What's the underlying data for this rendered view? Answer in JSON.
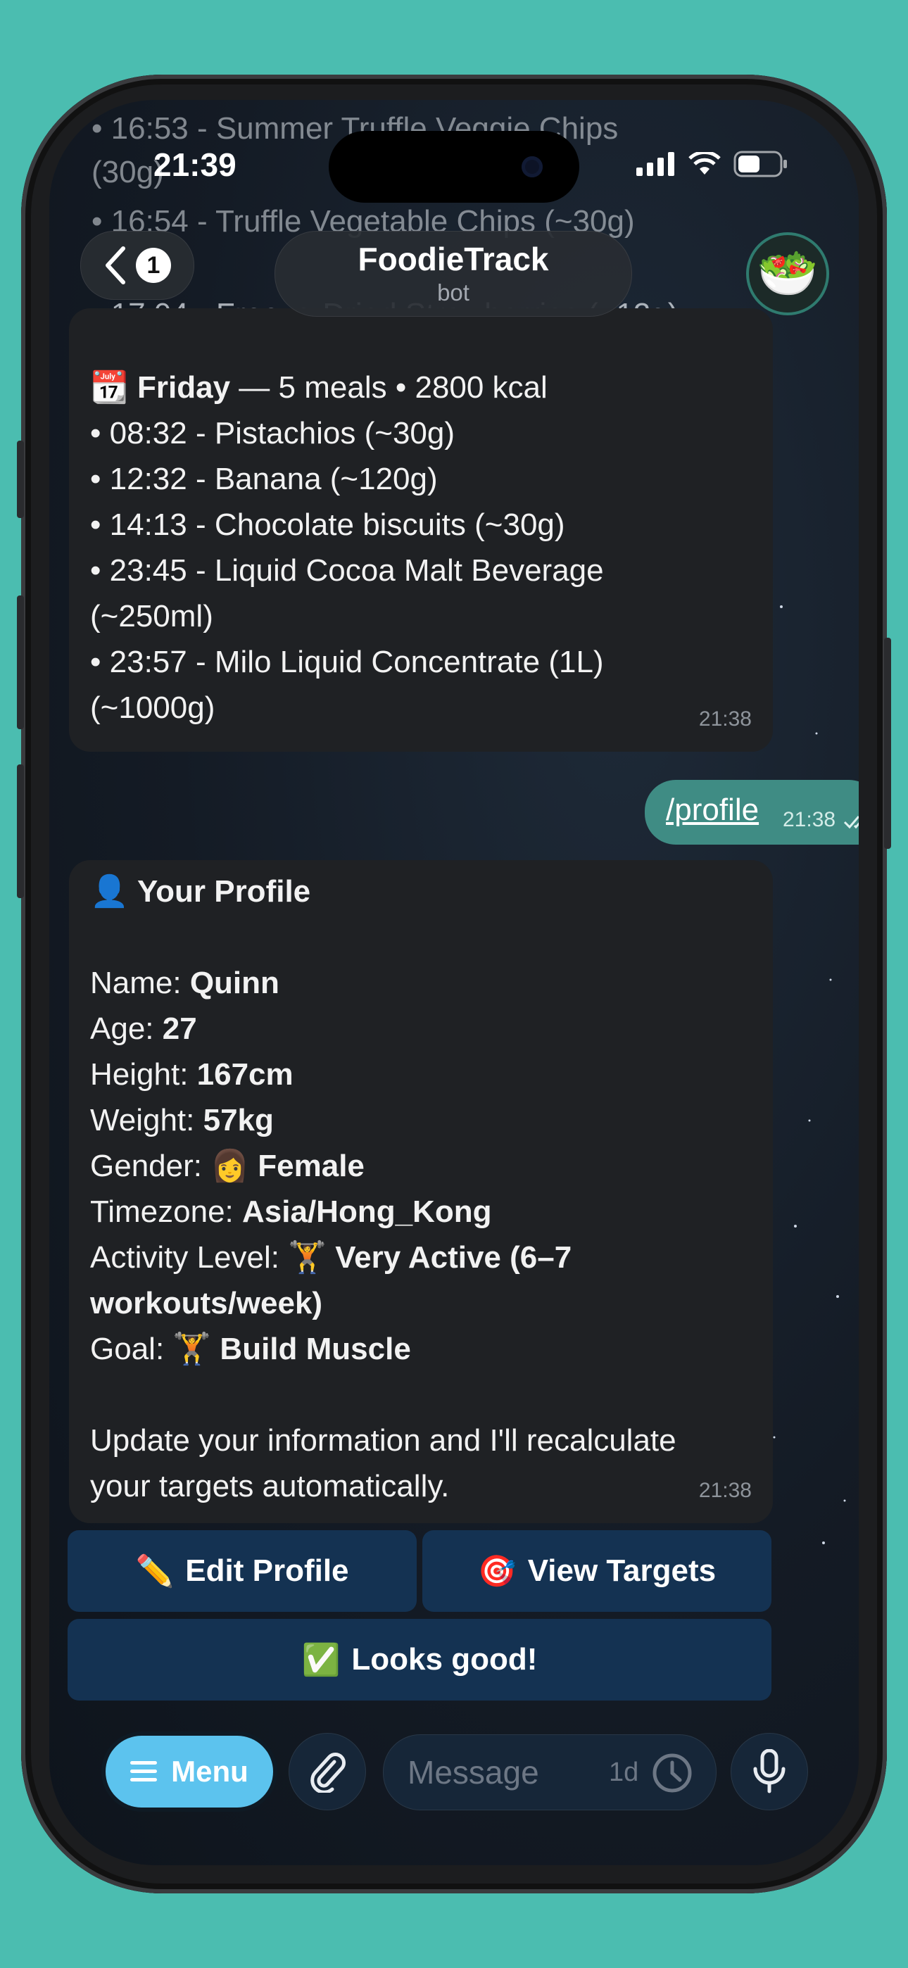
{
  "status_bar": {
    "time": "21:39"
  },
  "header": {
    "back_badge": "1",
    "title": "FoodieTrack",
    "subtitle": "bot",
    "avatar_emoji": "🥗"
  },
  "faded_lines": [
    "• 16:53 - Summer Truffle Veggie Chips",
    "(30g)",
    "• 16:54 - Truffle Vegetable Chips (~30g)",
    "• 17:04 - Freeze-Dried Strawberries (~12g)"
  ],
  "day_message": {
    "day_emoji": "📆",
    "day": "Friday",
    "summary": " — 5 meals • 2800 kcal",
    "lines": [
      "• 08:32 - Pistachios (~30g)",
      "• 12:32 - Banana (~120g)",
      "• 14:13 - Chocolate biscuits (~30g)",
      "• 23:45 - Liquid Cocoa Malt Beverage",
      "(~250ml)",
      "• 23:57 - Milo Liquid Concentrate (1L)",
      "(~1000g)"
    ],
    "time": "21:38"
  },
  "outgoing": {
    "text": "/profile",
    "time": "21:38"
  },
  "profile_message": {
    "title_emoji": "👤",
    "title": "Your Profile",
    "name_label": "Name: ",
    "name": "Quinn",
    "age_label": "Age: ",
    "age": "27",
    "height_label": "Height: ",
    "height": "167cm",
    "weight_label": "Weight: ",
    "weight": "57kg",
    "gender_label": "Gender: ",
    "gender_emoji": "👩",
    "gender": "Female",
    "timezone_label": "Timezone: ",
    "timezone": "Asia/Hong_Kong",
    "activity_label": "Activity Level: ",
    "activity_emoji": "🏋️",
    "activity_line1": "Very Active (6–7",
    "activity_line2": "workouts/week)",
    "goal_label": "Goal: ",
    "goal_emoji": "🏋️",
    "goal": "Build Muscle",
    "footer_line1": "Update your information and I'll recalculate",
    "footer_line2": "your targets automatically.",
    "time": "21:38"
  },
  "keyboard": {
    "edit_emoji": "✏️",
    "edit_label": "Edit Profile",
    "targets_emoji": "🎯",
    "targets_label": "View Targets",
    "ok_emoji": "✅",
    "ok_label": "Looks good!"
  },
  "input_bar": {
    "menu_label": "Menu",
    "placeholder": "Message",
    "timer_label": "1d"
  },
  "colors": {
    "background": "#4bbdb0",
    "bubble_in": "#1f2124",
    "bubble_out": "#3f8c84",
    "keyboard_button": "#143252",
    "menu_button": "#5cc3ee"
  }
}
